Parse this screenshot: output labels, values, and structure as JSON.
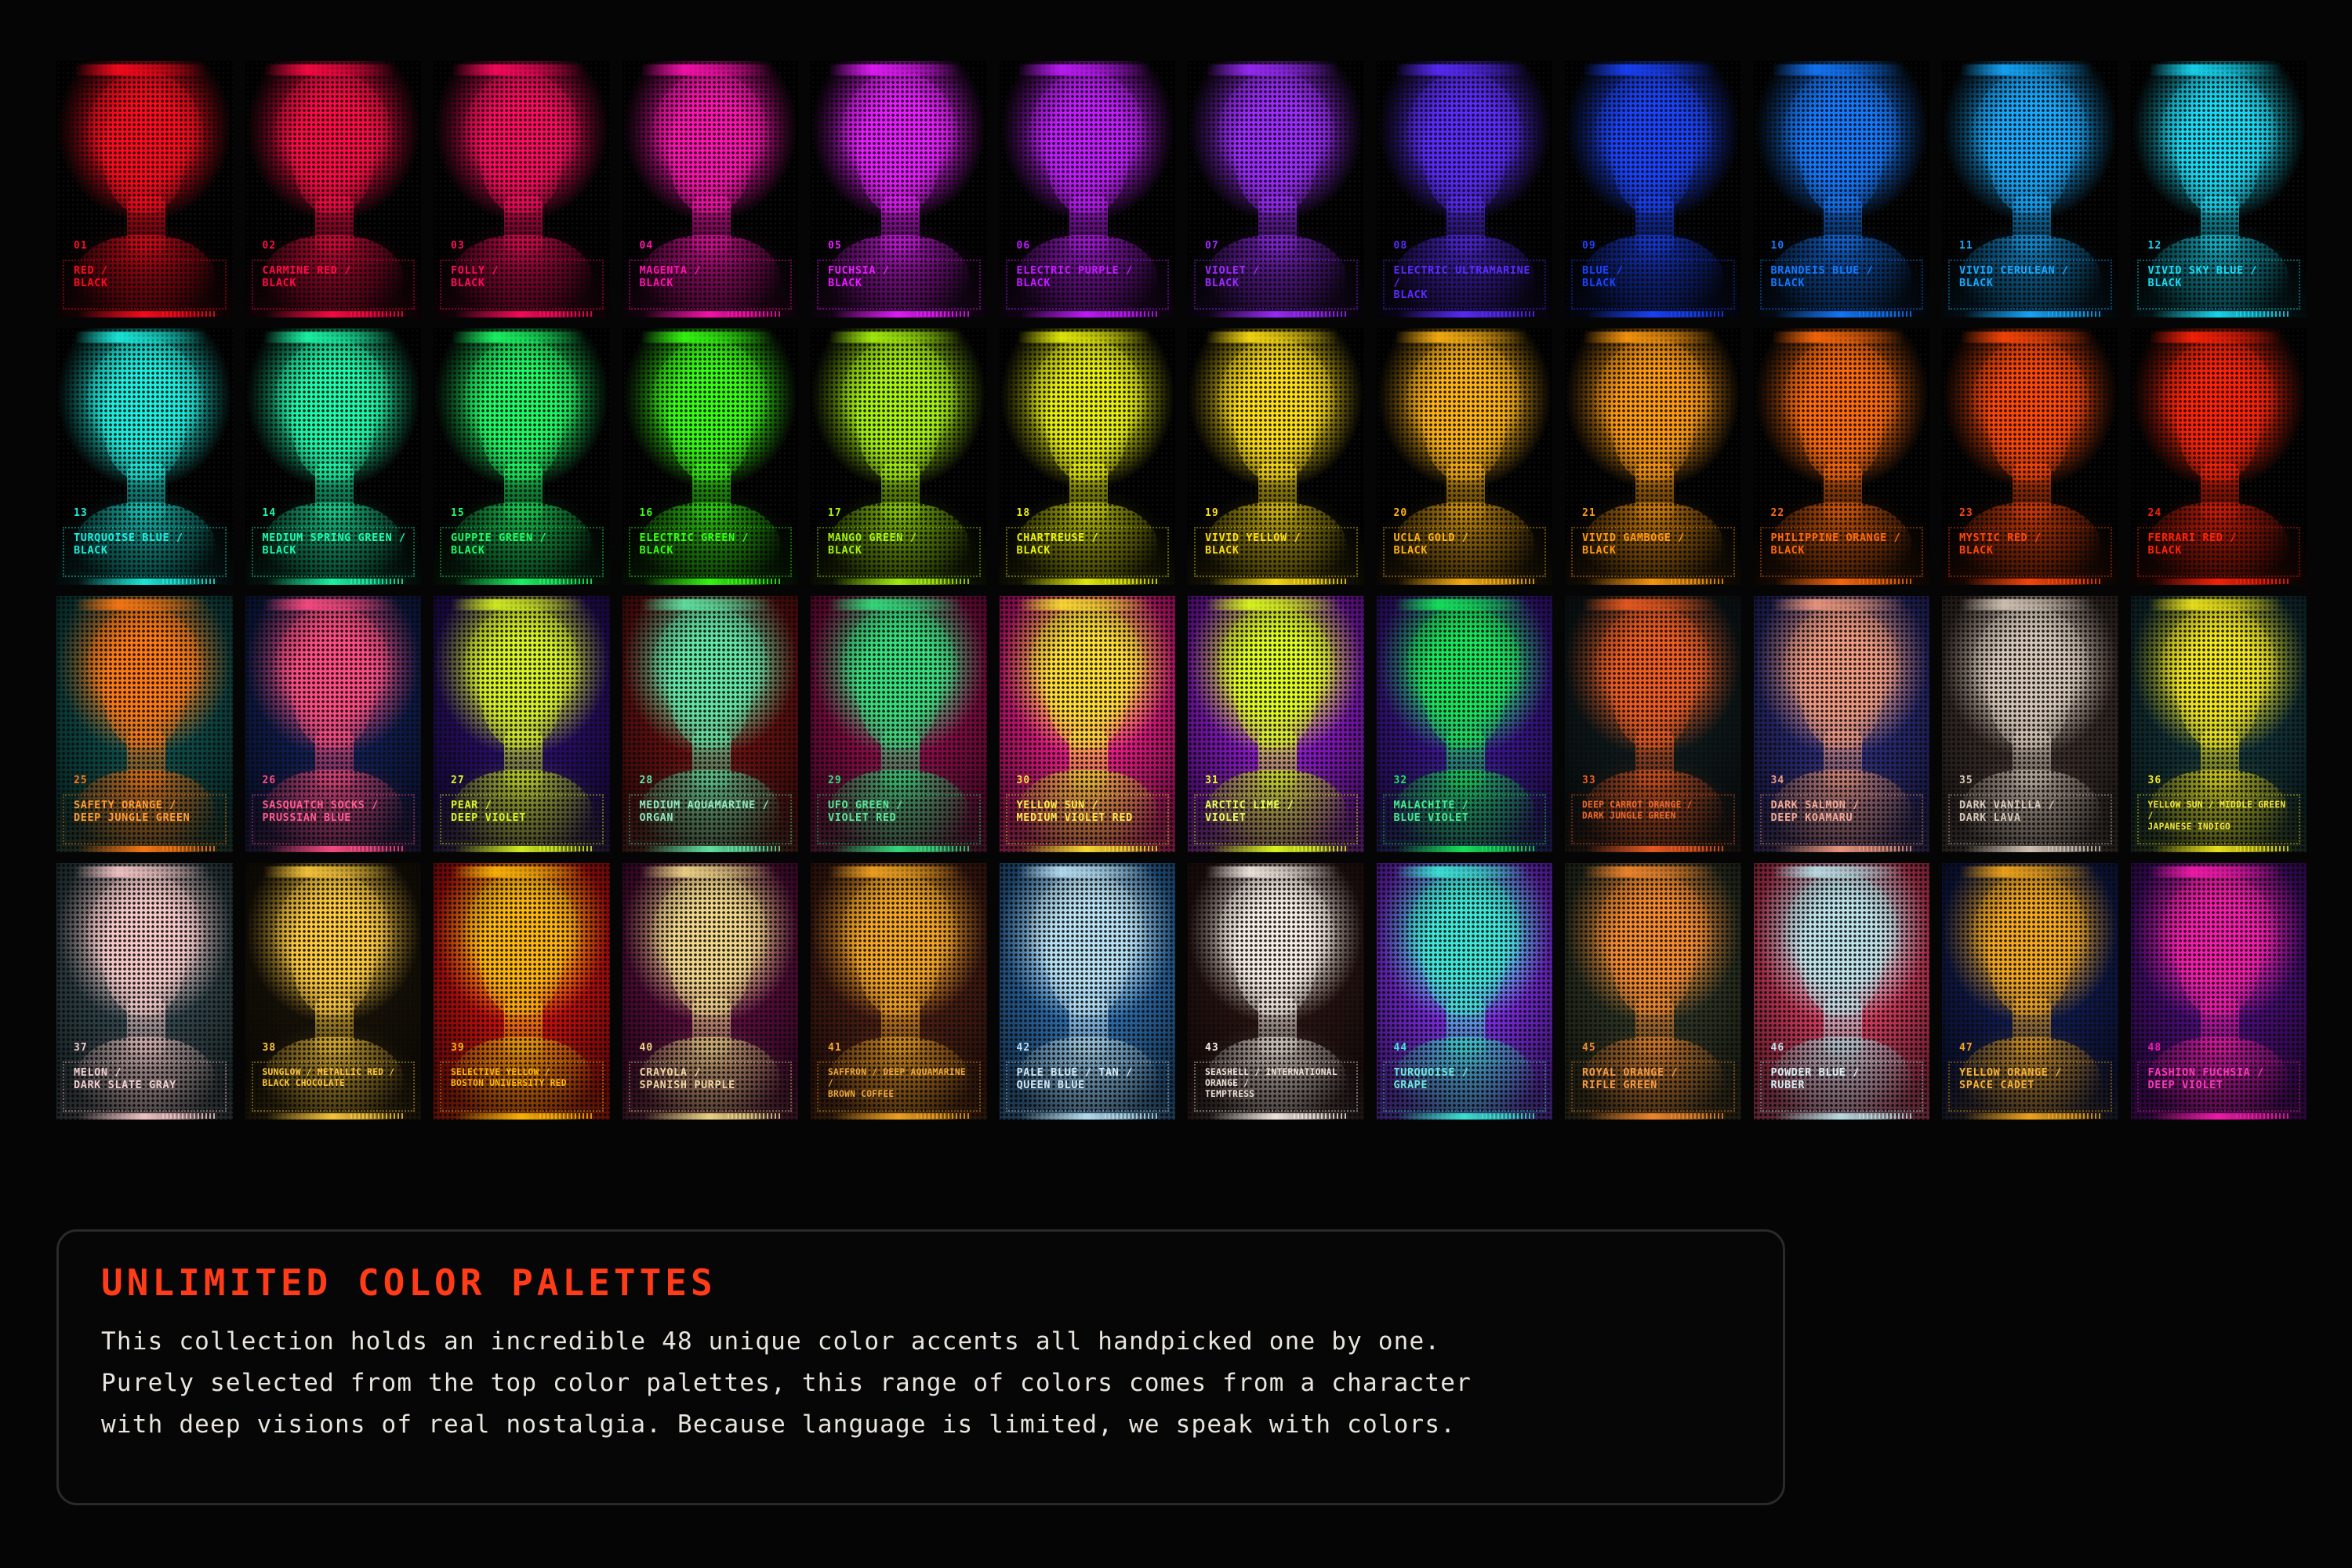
{
  "meta": {
    "background": "#050505",
    "accent": "#ff3b18"
  },
  "caption": {
    "title": "UNLIMITED COLOR PALETTES",
    "body": "This collection holds an incredible 48 unique color accents all handpicked one by one.\nPurely selected from the top color palettes, this range of colors comes from a character\nwith deep visions of real nostalgia. Because language is limited, we speak with colors."
  },
  "grid": {
    "rows": 4,
    "columns": 12,
    "total": 48
  },
  "cards": [
    {
      "index": "01",
      "name": "RED /\nBLACK",
      "accent": "#ff0a1e",
      "bg": "#000000",
      "text": "#ff0a1e"
    },
    {
      "index": "02",
      "name": "CARMINE RED /\nBLACK",
      "accent": "#ff0a45",
      "bg": "#000000",
      "text": "#ff0a45"
    },
    {
      "index": "03",
      "name": "FOLLY /\nBLACK",
      "accent": "#ff0a5e",
      "bg": "#000000",
      "text": "#ff0a5e"
    },
    {
      "index": "04",
      "name": "MAGENTA /\nBLACK",
      "accent": "#ff12b0",
      "bg": "#000000",
      "text": "#ff12b0"
    },
    {
      "index": "05",
      "name": "FUCHSIA /\nBLACK",
      "accent": "#e81cff",
      "bg": "#000000",
      "text": "#e81cff"
    },
    {
      "index": "06",
      "name": "ELECTRIC PURPLE /\nBLACK",
      "accent": "#c31cff",
      "bg": "#000000",
      "text": "#c31cff"
    },
    {
      "index": "07",
      "name": "VIOLET /\nBLACK",
      "accent": "#9d2bff",
      "bg": "#000000",
      "text": "#9d2bff"
    },
    {
      "index": "08",
      "name": "ELECTRIC ULTRAMARINE /\nBLACK",
      "accent": "#5a2bff",
      "bg": "#000000",
      "text": "#5a2bff"
    },
    {
      "index": "09",
      "name": "BLUE /\nBLACK",
      "accent": "#1a43ff",
      "bg": "#000000",
      "text": "#1a43ff"
    },
    {
      "index": "10",
      "name": "BRANDEIS BLUE /\nBLACK",
      "accent": "#1479ff",
      "bg": "#000000",
      "text": "#1479ff"
    },
    {
      "index": "11",
      "name": "VIVID CERULEAN /\nBLACK",
      "accent": "#16a9ff",
      "bg": "#000000",
      "text": "#16a9ff"
    },
    {
      "index": "12",
      "name": "VIVID SKY BLUE /\nBLACK",
      "accent": "#18dbf5",
      "bg": "#000000",
      "text": "#18dbf5"
    },
    {
      "index": "13",
      "name": "TURQUOISE BLUE /\nBLACK",
      "accent": "#1cf0e0",
      "bg": "#000000",
      "text": "#1cf0e0"
    },
    {
      "index": "14",
      "name": "MEDIUM SPRING GREEN /\nBLACK",
      "accent": "#1cfcaa",
      "bg": "#000000",
      "text": "#1cfcaa"
    },
    {
      "index": "15",
      "name": "GUPPIE GREEN /\nBLACK",
      "accent": "#1cfc66",
      "bg": "#000000",
      "text": "#1cfc66"
    },
    {
      "index": "16",
      "name": "ELECTRIC GREEN /\nBLACK",
      "accent": "#36ff12",
      "bg": "#000000",
      "text": "#36ff12"
    },
    {
      "index": "17",
      "name": "MANGO GREEN /\nBLACK",
      "accent": "#a8f50e",
      "bg": "#000000",
      "text": "#a8f50e"
    },
    {
      "index": "18",
      "name": "CHARTREUSE /\nBLACK",
      "accent": "#eaf20a",
      "bg": "#000000",
      "text": "#eaf20a"
    },
    {
      "index": "19",
      "name": "VIVID YELLOW /\nBLACK",
      "accent": "#ffdf14",
      "bg": "#000000",
      "text": "#ffdf14"
    },
    {
      "index": "20",
      "name": "UCLA GOLD /\nBLACK",
      "accent": "#ffb313",
      "bg": "#000000",
      "text": "#ffb313"
    },
    {
      "index": "21",
      "name": "VIVID GAMBOGE /\nBLACK",
      "accent": "#ff9a0f",
      "bg": "#000000",
      "text": "#ff9a0f"
    },
    {
      "index": "22",
      "name": "PHILIPPINE ORANGE /\nBLACK",
      "accent": "#ff6a0b",
      "bg": "#000000",
      "text": "#ff6a0b"
    },
    {
      "index": "23",
      "name": "MYSTIC RED /\nBLACK",
      "accent": "#ff4708",
      "bg": "#000000",
      "text": "#ff4708"
    },
    {
      "index": "24",
      "name": "FERRARI RED /\nBLACK",
      "accent": "#ff2208",
      "bg": "#000000",
      "text": "#ff2208"
    },
    {
      "index": "25",
      "name": "SAFETY ORANGE /\nDEEP JUNGLE GREEN",
      "accent": "#ff7a14",
      "bg": "#0d4d4a",
      "text": "#ff9d33"
    },
    {
      "index": "26",
      "name": "SASQUATCH SOCKS /\nPRUSSIAN BLUE",
      "accent": "#ff4d83",
      "bg": "#101f56",
      "text": "#ff5c8f"
    },
    {
      "index": "27",
      "name": "PEAR /\nDEEP VIOLET",
      "accent": "#d9f522",
      "bg": "#280d6b",
      "text": "#d9f522"
    },
    {
      "index": "28",
      "name": "MEDIUM AQUAMARINE /\nORGAN",
      "accent": "#62e8a5",
      "bg": "#6b1010",
      "text": "#8fe8bd"
    },
    {
      "index": "29",
      "name": "UFO GREEN /\nVIOLET RED",
      "accent": "#35e07e",
      "bg": "#8c0b48",
      "text": "#56e897"
    },
    {
      "index": "30",
      "name": "YELLOW SUN /\nMEDIUM VIOLET RED",
      "accent": "#ffe033",
      "bg": "#e81885",
      "text": "#ffe84a"
    },
    {
      "index": "31",
      "name": "ARCTIC LIME /\nVIOLET",
      "accent": "#e0ff1c",
      "bg": "#8a18c7",
      "text": "#e8ff52"
    },
    {
      "index": "32",
      "name": "MALACHITE /\nBLUE VIOLET",
      "accent": "#16e85c",
      "bg": "#3a1591",
      "text": "#46e890"
    },
    {
      "index": "33",
      "name": "DEEP CARROT ORANGE /\nDARK JUNGLE GREEN",
      "accent": "#ef5c22",
      "bg": "#0f1a1c",
      "text": "#ef6a2e"
    },
    {
      "index": "34",
      "name": "DARK SALMON /\nDEEP KOAMARU",
      "accent": "#f09a80",
      "bg": "#2a2a78",
      "text": "#f0a894"
    },
    {
      "index": "35",
      "name": "DARK VANILLA /\nDARK LAVA",
      "accent": "#d6c7b8",
      "bg": "#3a2e2a",
      "text": "#d6c7b8"
    },
    {
      "index": "36",
      "name": "YELLOW SUN / MIDDLE GREEN /\nJAPANESE INDIGO",
      "accent": "#f2e81c",
      "bg": "#12343a",
      "text": "#f2e83a"
    },
    {
      "index": "37",
      "name": "MELON /\nDARK SLATE GRAY",
      "accent": "#f7c9c9",
      "bg": "#33474d",
      "text": "#f0cfcf"
    },
    {
      "index": "38",
      "name": "SUNGLOW / METALLIC RED /\nBLACK CHOCOLATE",
      "accent": "#ffcb3d",
      "bg": "#191206",
      "text": "#ffc73d"
    },
    {
      "index": "39",
      "name": "SELECTIVE YELLOW /\nBOSTON UNIVERSITY RED",
      "accent": "#ffb80a",
      "bg": "#c90d0d",
      "text": "#ffb80a"
    },
    {
      "index": "40",
      "name": "CRAYOLA /\nSPANISH PURPLE",
      "accent": "#f2d88a",
      "bg": "#5c0c3e",
      "text": "#f0d4a0"
    },
    {
      "index": "41",
      "name": "SAFFRON / DEEP AQUAMARINE /\nBROWN COFFEE",
      "accent": "#f5a623",
      "bg": "#4a1d12",
      "text": "#f0a83a"
    },
    {
      "index": "42",
      "name": "PALE BLUE / TAN /\nQUEEN BLUE",
      "accent": "#b9e2f5",
      "bg": "#2b6aa8",
      "text": "#cfe8f7"
    },
    {
      "index": "43",
      "name": "SEASHELL / INTERNATIONAL ORANGE /\nTEMPTRESS",
      "accent": "#f5ece4",
      "bg": "#2a1412",
      "text": "#f0e2d8"
    },
    {
      "index": "44",
      "name": "TURQUOISE /\nGRAPE",
      "accent": "#3de8d8",
      "bg": "#7a2ae0",
      "text": "#6de8dd"
    },
    {
      "index": "45",
      "name": "ROYAL ORANGE /\nRIFLE GREEN",
      "accent": "#f58a2e",
      "bg": "#2e3524",
      "text": "#f59a45"
    },
    {
      "index": "46",
      "name": "POWDER BLUE /\nRUBER",
      "accent": "#bde3ea",
      "bg": "#d13a5c",
      "text": "#d8eef2"
    },
    {
      "index": "47",
      "name": "YELLOW ORANGE /\nSPACE CADET",
      "accent": "#f5a81c",
      "bg": "#101b52",
      "text": "#f5b034"
    },
    {
      "index": "48",
      "name": "FASHION FUCHSIA /\nDEEP VIOLET",
      "accent": "#f51cab",
      "bg": "#4a0c7a",
      "text": "#f53ab5"
    }
  ]
}
